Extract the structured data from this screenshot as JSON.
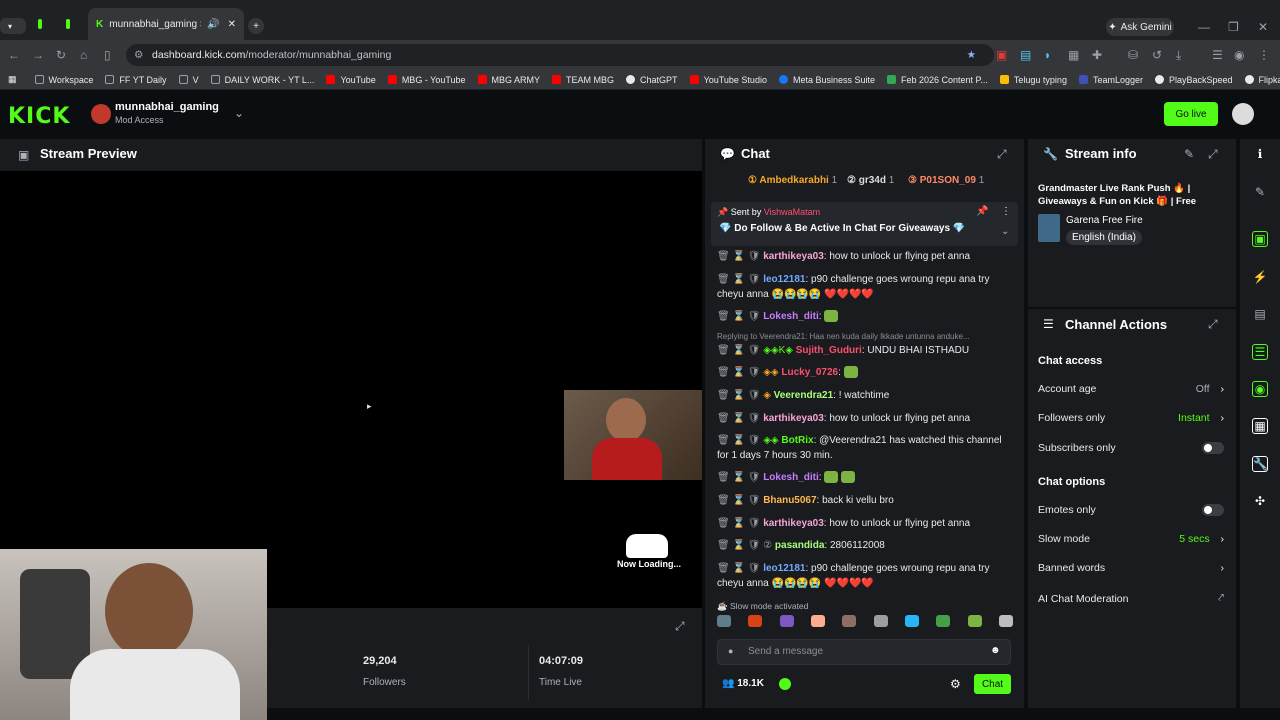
{
  "browser": {
    "tab_title": "munnabhai_gaming Stream",
    "url_host": "dashboard.kick.com",
    "url_path": "/moderator/munnabhai_gaming",
    "ask_gemini": "Ask Gemini",
    "bookmarks": [
      "Workspace",
      "FF YT Daily",
      "V",
      "DAILY WORK - YT L...",
      "YouTube",
      "MBG - YouTube",
      "MBG ARMY",
      "TEAM MBG",
      "ChatGPT",
      "YouTube Studio",
      "Meta Business Suite",
      "Feb 2026 Content P...",
      "Telugu typing",
      "TeamLogger",
      "PlayBackSpeed",
      "Flipkart paylater"
    ]
  },
  "header": {
    "logo": "KICK",
    "channel_name": "munnabhai_gaming",
    "access": "Mod Access",
    "go_live": "Go live"
  },
  "preview": {
    "title": "Stream Preview",
    "loading": "Now Loading...",
    "followers_value": "29,204",
    "followers_label": "Followers",
    "time_value": "04:07:09",
    "time_label": "Time Live"
  },
  "chat": {
    "title": "Chat",
    "top_gifters": [
      {
        "name": "Ambedkarabhi",
        "count": "1"
      },
      {
        "name": "gr34d",
        "count": "1"
      },
      {
        "name": "P01SON_09",
        "count": "1"
      }
    ],
    "pinned_sent_by": "Sent by",
    "pinned_user": "VishwaMatam",
    "pinned_message": "Do Follow & Be Active In Chat For Giveaways",
    "reply_context": "Replying to Veerendra21: Haa nen kuda daily lkkade untunna anduke...",
    "messages": [
      {
        "user": "karthikeya03",
        "text": "how to unlock ur flying pet anna",
        "color": "#f6a5d6"
      },
      {
        "user": "leo12181",
        "text": "p90 challenge goes wroung repu ana try cheyu anna",
        "color": "#75a9ff"
      },
      {
        "user": "Lokesh_diti",
        "text": "",
        "color": "#c77dff"
      },
      {
        "user": "Sujith_Guduri",
        "text": "UNDU BHAI ISTHADU",
        "color": "#ff4f6d"
      },
      {
        "user": "Lucky_0726",
        "text": "",
        "color": "#ff4f6d"
      },
      {
        "user": "Veerendra21",
        "text": "! watchtime",
        "color": "#a8ff7a"
      },
      {
        "user": "karthikeya03",
        "text": "how to unlock ur flying pet anna",
        "color": "#f6a5d6"
      },
      {
        "user": "BotRix",
        "text": "@Veerendra21 has watched this channel for 1 days 7 hours 30 min.",
        "color": "#53fc18"
      },
      {
        "user": "Lokesh_diti",
        "text": "",
        "color": "#c77dff"
      },
      {
        "user": "Bhanu5067",
        "text": "back ki vellu bro",
        "color": "#ffb84d"
      },
      {
        "user": "karthikeya03",
        "text": "how to unlock ur flying pet anna",
        "color": "#f6a5d6"
      },
      {
        "user": "pasandida",
        "text": "2806112008",
        "color": "#a8ff7a"
      },
      {
        "user": "leo12181",
        "text": "p90 challenge goes wroung repu ana try cheyu anna",
        "color": "#75a9ff"
      }
    ],
    "slow_mode_notice": "Slow mode activated",
    "input_placeholder": "Send a message",
    "viewers": "18.1K",
    "send_button": "Chat"
  },
  "stream_info": {
    "title": "Stream info",
    "stream_title": "Grandmaster Live Rank Push 🔥 | Giveaways & Fun on Kick 🎁 | Free Fire...",
    "game": "Garena Free Fire",
    "language": "English (India)"
  },
  "channel_actions": {
    "title": "Channel Actions",
    "chat_access_heading": "Chat access",
    "account_age_label": "Account age",
    "account_age_value": "Off",
    "followers_only_label": "Followers only",
    "followers_only_value": "Instant",
    "subscribers_only_label": "Subscribers only",
    "chat_options_heading": "Chat options",
    "emotes_only_label": "Emotes only",
    "slow_mode_label": "Slow mode",
    "slow_mode_value": "5 secs",
    "banned_words_label": "Banned words",
    "ai_moderation_label": "AI Chat Moderation"
  },
  "colors": {
    "accent": "#53fc18",
    "panel": "#191b1f",
    "background": "#0b0e11"
  }
}
